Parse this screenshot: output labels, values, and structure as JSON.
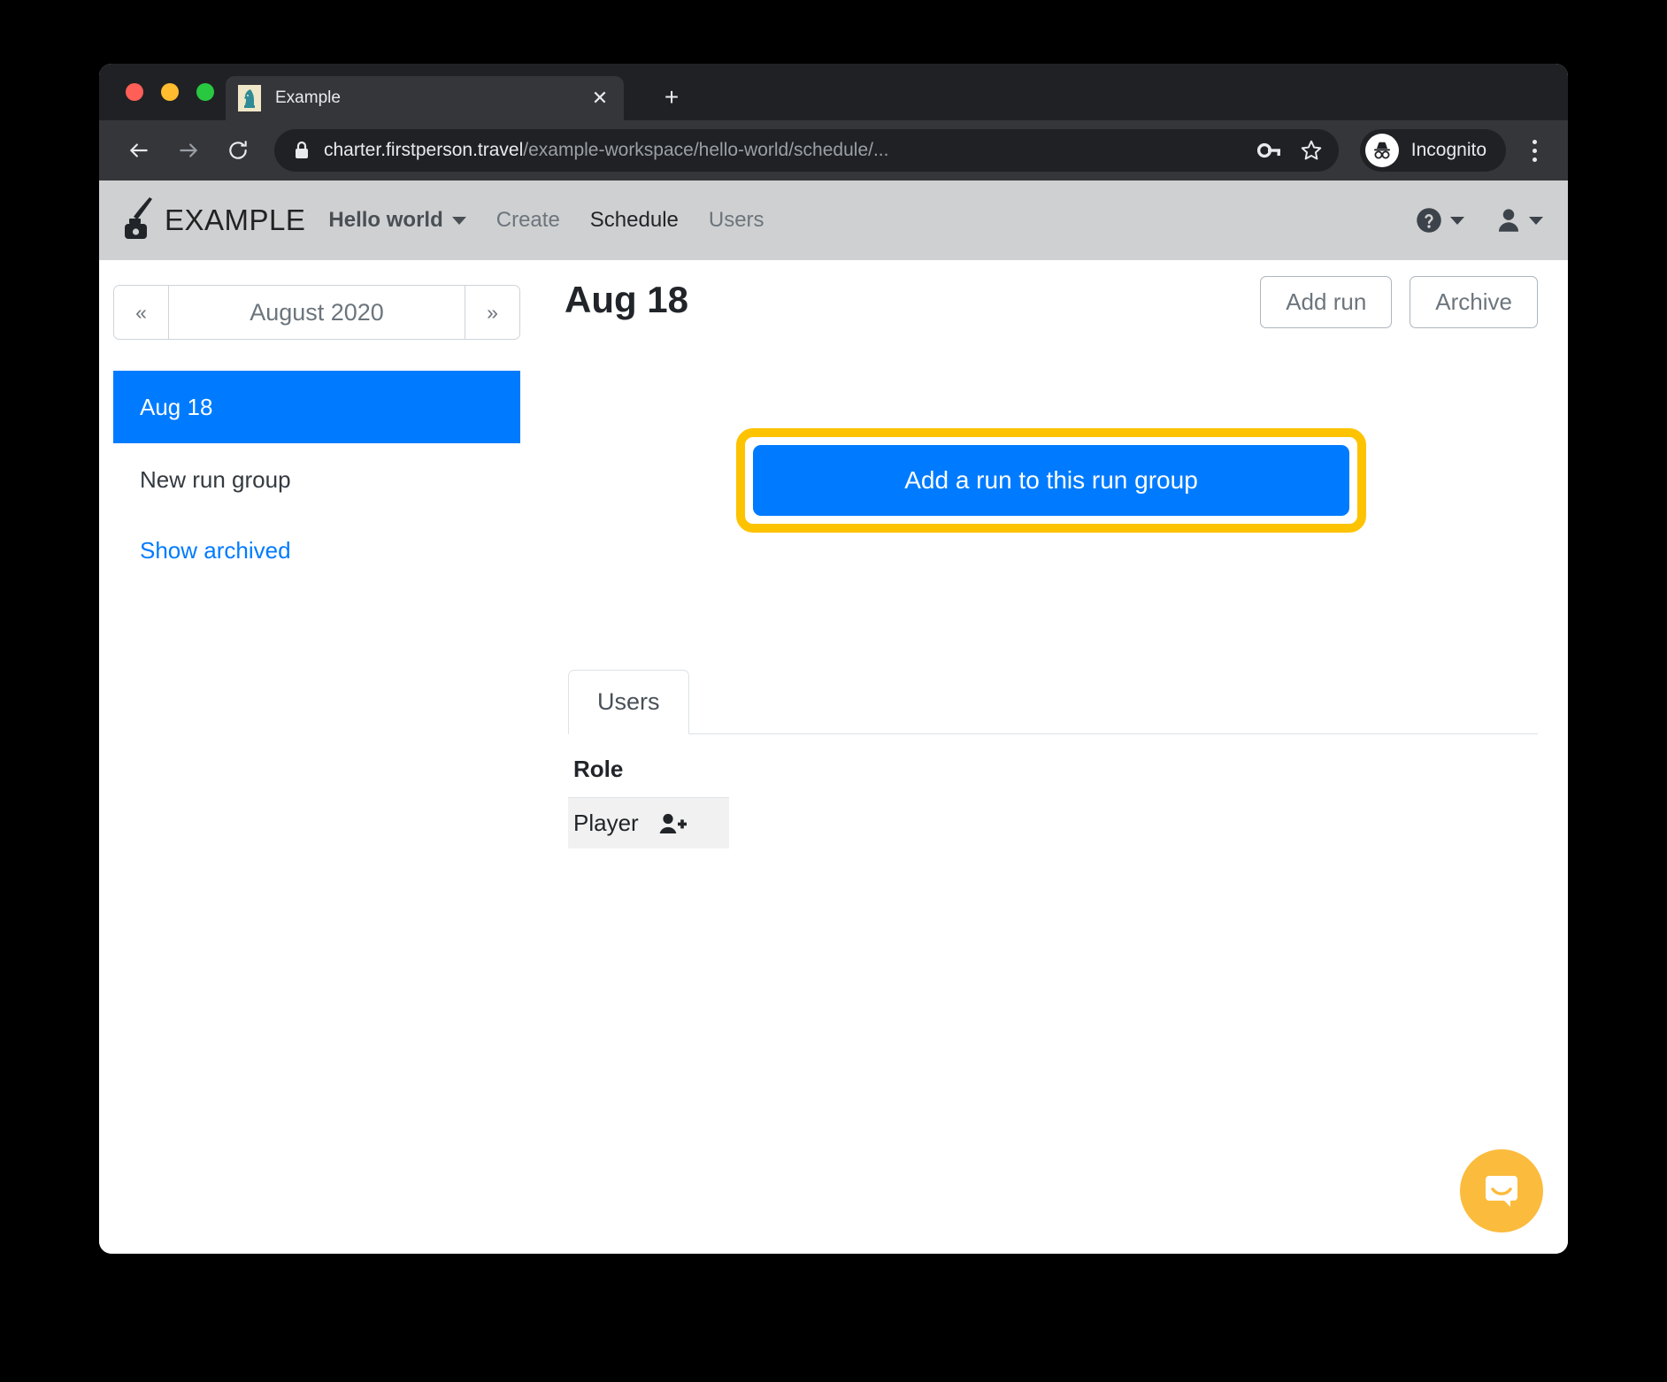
{
  "browser": {
    "tab": {
      "title": "Example",
      "favicon_icon": "chess-knight-icon",
      "close_icon": "close-icon"
    },
    "new_tab_label": "+",
    "back_icon": "back-arrow-icon",
    "forward_icon": "forward-arrow-icon",
    "reload_icon": "reload-icon",
    "lock_icon": "lock-icon",
    "url_domain": "charter.firstperson.travel",
    "url_path": "/example-workspace/hello-world/schedule/...",
    "key_icon": "key-icon",
    "star_icon": "star-icon",
    "incognito_label": "Incognito",
    "incognito_icon": "incognito-icon",
    "menu_icon": "kebab-menu-icon"
  },
  "appnav": {
    "logo_icon": "inkwell-quill-icon",
    "brand": "EXAMPLE",
    "workspace": "Hello world",
    "workspace_caret_icon": "chevron-down-icon",
    "items": [
      {
        "label": "Create",
        "active": false
      },
      {
        "label": "Schedule",
        "active": true
      },
      {
        "label": "Users",
        "active": false
      }
    ],
    "help_icon": "help-circle-icon",
    "help_caret_icon": "chevron-down-icon",
    "account_icon": "user-icon",
    "account_caret_icon": "chevron-down-icon"
  },
  "sidebar": {
    "prev_label": "«",
    "month_label": "August 2020",
    "next_label": "»",
    "days": [
      {
        "label": "Aug 18",
        "selected": true
      },
      {
        "label": "New run group",
        "selected": false
      }
    ],
    "show_archived_label": "Show archived"
  },
  "main": {
    "title": "Aug 18",
    "add_run_label": "Add run",
    "archive_label": "Archive",
    "cta_label": "Add a run to this run group",
    "cta_highlight_color": "#fdc300",
    "primary_color": "#007bff",
    "tabs": [
      {
        "label": "Users",
        "active": true
      }
    ],
    "table": {
      "columns": [
        "Role"
      ],
      "rows": [
        {
          "role": "Player",
          "action_icon": "user-plus-icon"
        }
      ]
    }
  },
  "launcher": {
    "icon": "intercom-chat-icon",
    "color": "#fbbb3c"
  }
}
